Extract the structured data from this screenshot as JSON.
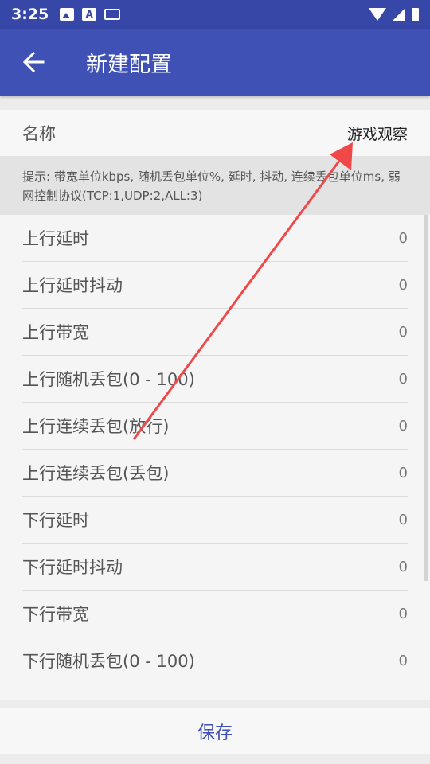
{
  "status_bar": {
    "time": "3:25",
    "a_icon_text": "A"
  },
  "app_bar": {
    "title": "新建配置"
  },
  "name_row": {
    "label": "名称",
    "value": "游戏观察"
  },
  "hint": "提示: 带宽单位kbps, 随机丢包单位%, 延时, 抖动, 连续丢包单位ms, 弱网控制协议(TCP:1,UDP:2,ALL:3)",
  "rows": [
    {
      "label": "上行延时",
      "value": "0"
    },
    {
      "label": "上行延时抖动",
      "value": "0"
    },
    {
      "label": "上行带宽",
      "value": "0"
    },
    {
      "label": "上行随机丢包(0 - 100)",
      "value": "0"
    },
    {
      "label": "上行连续丢包(放行)",
      "value": "0"
    },
    {
      "label": "上行连续丢包(丢包)",
      "value": "0"
    },
    {
      "label": "下行延时",
      "value": "0"
    },
    {
      "label": "下行延时抖动",
      "value": "0"
    },
    {
      "label": "下行带宽",
      "value": "0"
    },
    {
      "label": "下行随机丢包(0 - 100)",
      "value": "0"
    }
  ],
  "save_button": {
    "label": "保存"
  },
  "colors": {
    "primary": "#3f51b5",
    "status_bar": "#3747a8",
    "annotation_arrow": "#f04848"
  }
}
